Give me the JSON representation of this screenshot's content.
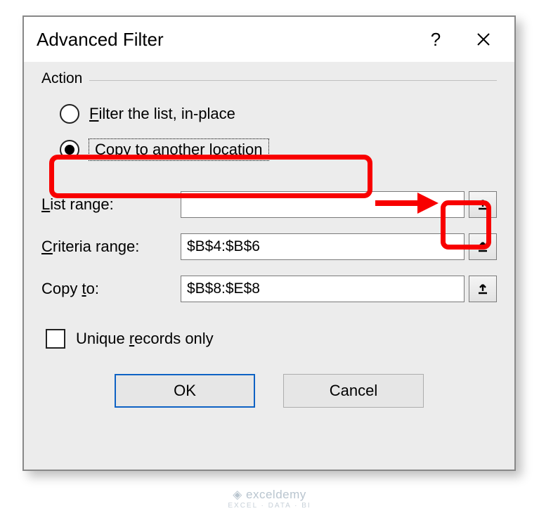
{
  "dialog": {
    "title": "Advanced Filter",
    "help_label": "?",
    "close_label": "✕"
  },
  "action": {
    "group_label": "Action",
    "filter_in_place_label_pre": "",
    "filter_in_place_underline": "F",
    "filter_in_place_label_post": "ilter the list, in-place",
    "copy_to_underline": "o",
    "copy_to_pre": "C",
    "copy_to_post": "py to another location"
  },
  "fields": {
    "list_range_label_underline": "L",
    "list_range_label_rest": "ist range:",
    "list_range_value": "",
    "criteria_label_underline": "C",
    "criteria_label_rest": "riteria range:",
    "criteria_value": "$B$4:$B$6",
    "copy_to_label_pre": "Copy ",
    "copy_to_label_underline": "t",
    "copy_to_label_post": "o:",
    "copy_to_value": "$B$8:$E$8"
  },
  "unique": {
    "pre": "Unique ",
    "underline": "r",
    "post": "ecords only"
  },
  "buttons": {
    "ok": "OK",
    "cancel": "Cancel"
  },
  "watermark": {
    "brand": "exceldemy",
    "tagline": "EXCEL · DATA · BI"
  }
}
